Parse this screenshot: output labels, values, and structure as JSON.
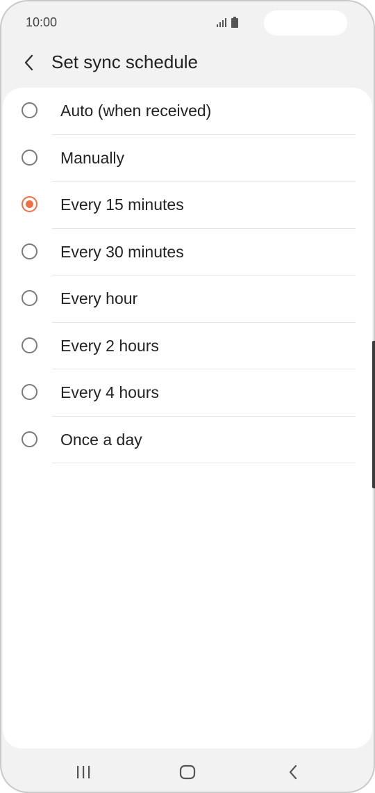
{
  "status_bar": {
    "time": "10:00",
    "icons": [
      "signal-icon",
      "battery-icon"
    ]
  },
  "header": {
    "back_icon": "chevron-left-icon",
    "title": "Set sync schedule"
  },
  "options": [
    {
      "label": "Auto (when received)",
      "selected": false
    },
    {
      "label": "Manually",
      "selected": false
    },
    {
      "label": "Every 15 minutes",
      "selected": true
    },
    {
      "label": "Every 30 minutes",
      "selected": false
    },
    {
      "label": "Every hour",
      "selected": false
    },
    {
      "label": "Every 2 hours",
      "selected": false
    },
    {
      "label": "Every 4 hours",
      "selected": false
    },
    {
      "label": "Once a day",
      "selected": false
    }
  ],
  "nav_bar": {
    "icons": [
      "recent-apps-icon",
      "home-icon",
      "back-icon"
    ]
  },
  "colors": {
    "accent": "#f06f43",
    "background": "#f2f2f2",
    "card": "#ffffff",
    "text": "#222222"
  }
}
